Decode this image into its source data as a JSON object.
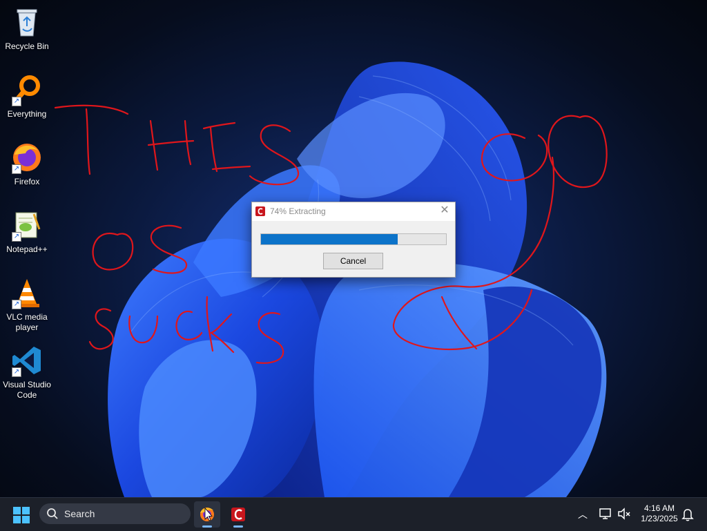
{
  "desktop": {
    "icons": [
      {
        "label": "Recycle Bin",
        "icon": "recycle-bin-icon"
      },
      {
        "label": "Everything",
        "icon": "everything-search-icon"
      },
      {
        "label": "Firefox",
        "icon": "firefox-icon"
      },
      {
        "label": "Notepad++",
        "icon": "notepad-plus-plus-icon"
      },
      {
        "label": "VLC media player",
        "icon": "vlc-icon"
      },
      {
        "label": "Visual Studio Code",
        "icon": "vscode-icon"
      }
    ],
    "scribble_color": "#e0161b"
  },
  "dialog": {
    "title": "74% Extracting",
    "progress_percent": 74,
    "cancel_label": "Cancel",
    "progress_color": "#0c73c9"
  },
  "taskbar": {
    "search_label": "Search",
    "time": "4:16 AM",
    "date": "1/23/2025"
  }
}
